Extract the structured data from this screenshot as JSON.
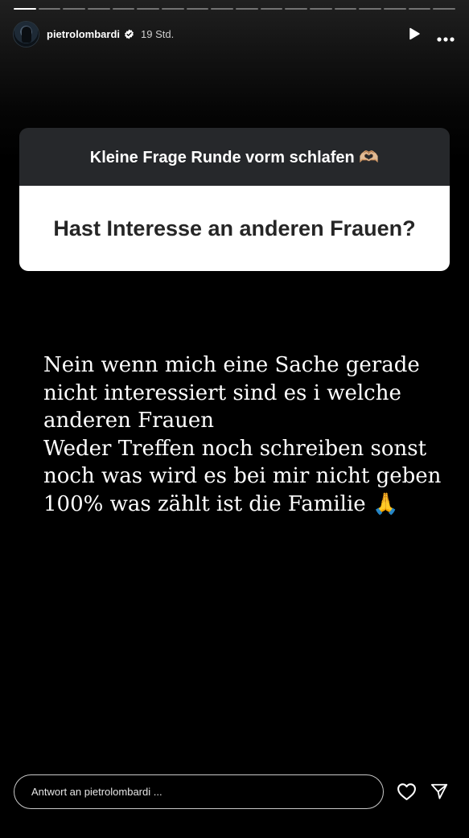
{
  "progress": {
    "segments": 18,
    "current": 0
  },
  "header": {
    "username": "pietrolombardi",
    "time": "19 Std."
  },
  "question_card": {
    "title": "Kleine Frage Runde vorm schlafen 🫶🏼",
    "question": "Hast Interesse an anderen Frauen?"
  },
  "answer": {
    "text": "Nein wenn mich eine Sache gerade\nnicht interessiert sind es i welche\nanderen Frauen\nWeder Treffen noch schreiben sonst\nnoch was wird es bei mir nicht geben\n100% was zählt ist die Familie 🙏"
  },
  "reply": {
    "placeholder": "Antwort an pietrolombardi ..."
  },
  "icons": {
    "verified": "verified-badge-icon",
    "play": "play-icon",
    "more": "more-icon",
    "heart": "heart-icon",
    "send": "send-icon"
  }
}
